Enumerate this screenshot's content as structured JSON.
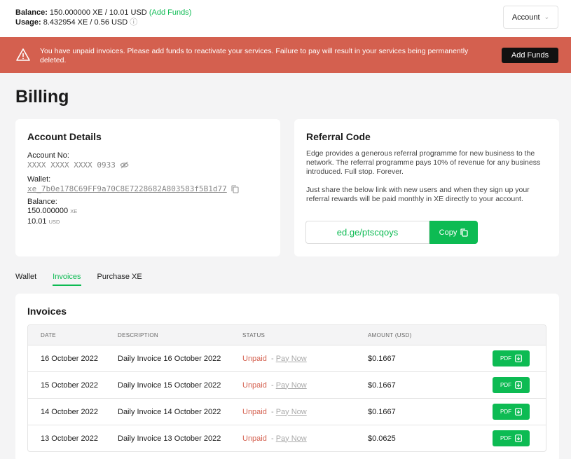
{
  "header": {
    "balance_label": "Balance:",
    "balance_value": "150.000000 XE / 10.01 USD",
    "add_funds_link": "Add Funds",
    "usage_label": "Usage:",
    "usage_value": "8.432954 XE / 0.56 USD",
    "account_button": "Account"
  },
  "alert": {
    "message": "You have unpaid invoices. Please add funds to reactivate your services. Failure to pay will result in your services being permanently deleted.",
    "button": "Add Funds"
  },
  "page_title": "Billing",
  "account_details": {
    "heading": "Account Details",
    "account_no_label": "Account No:",
    "account_no_value": "XXXX XXXX XXXX 0933",
    "wallet_label": "Wallet:",
    "wallet_value": "xe_7b0e178C69FF9a70C8E7228682A803583f5B1d77",
    "balance_label": "Balance:",
    "balance_xe": "150.000000",
    "balance_xe_unit": "XE",
    "balance_usd": "10.01",
    "balance_usd_unit": "USD"
  },
  "referral": {
    "heading": "Referral Code",
    "para1": "Edge provides a generous referral programme for new business to the network. The referral programme pays 10% of revenue for any business introduced. Full stop. Forever.",
    "para2": "Just share the below link with new users and when they sign up your referral rewards will be paid monthly in XE directly to your account.",
    "link": "ed.ge/ptscqoys",
    "copy_button": "Copy"
  },
  "tabs": [
    "Wallet",
    "Invoices",
    "Purchase XE"
  ],
  "invoices": {
    "heading": "Invoices",
    "columns": [
      "DATE",
      "DESCRIPTION",
      "STATUS",
      "AMOUNT (USD)"
    ],
    "rows": [
      {
        "date": "16 October 2022",
        "description": "Daily Invoice 16 October 2022",
        "status": "Unpaid",
        "action": "Pay Now",
        "amount": "$0.1667",
        "pdf": "PDF"
      },
      {
        "date": "15 October 2022",
        "description": "Daily Invoice 15 October 2022",
        "status": "Unpaid",
        "action": "Pay Now",
        "amount": "$0.1667",
        "pdf": "PDF"
      },
      {
        "date": "14 October 2022",
        "description": "Daily Invoice 14 October 2022",
        "status": "Unpaid",
        "action": "Pay Now",
        "amount": "$0.1667",
        "pdf": "PDF"
      },
      {
        "date": "13 October 2022",
        "description": "Daily Invoice 13 October 2022",
        "status": "Unpaid",
        "action": "Pay Now",
        "amount": "$0.0625",
        "pdf": "PDF"
      }
    ]
  },
  "colors": {
    "accent": "#0dbb53",
    "alert": "#d4604f",
    "dark": "#111111"
  }
}
